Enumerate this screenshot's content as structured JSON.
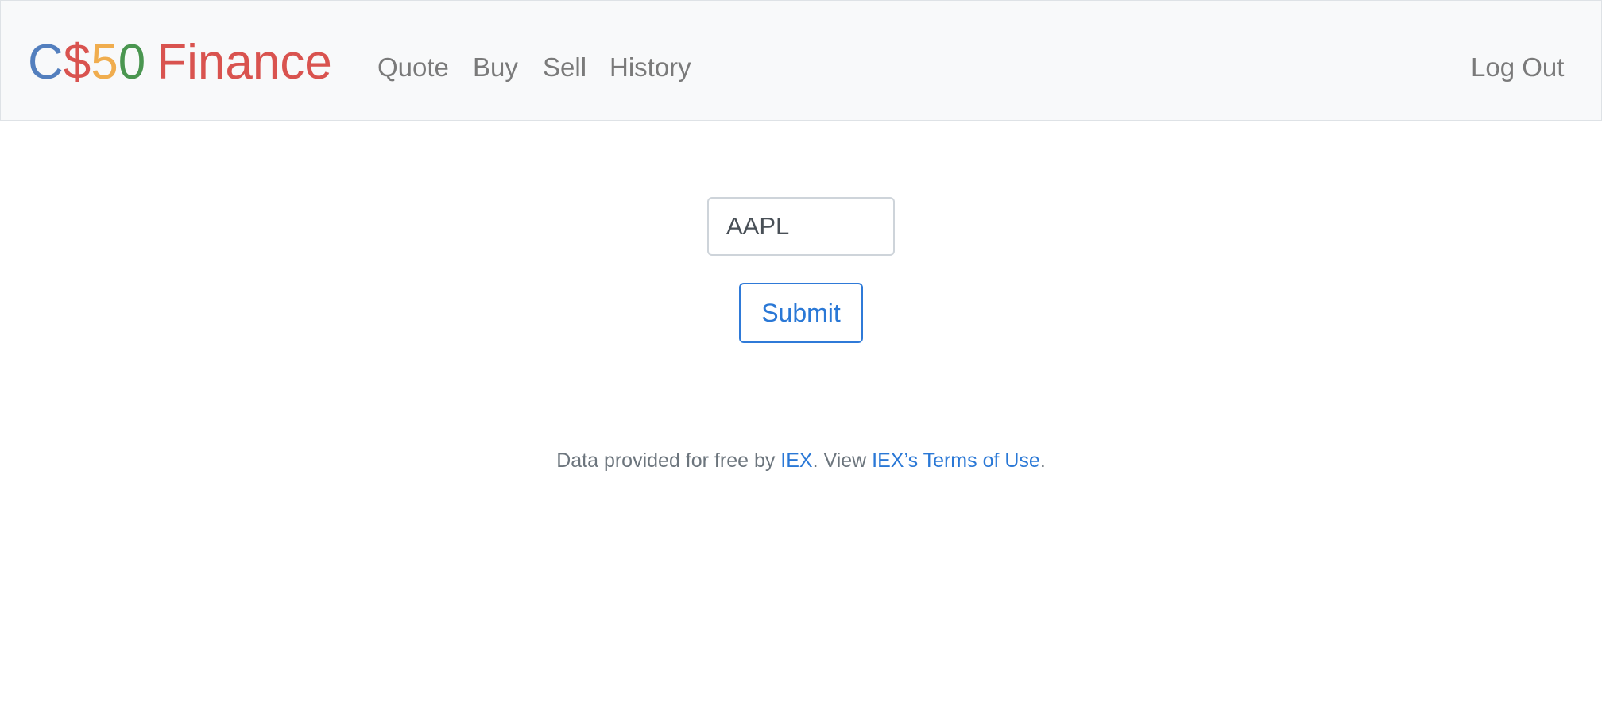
{
  "brand": {
    "c": "C",
    "dollar": "$",
    "five": "5",
    "zero": "0",
    "finance": "Finance",
    "colors": {
      "c": "#537fbe",
      "dollar": "#d9534f",
      "five": "#f0ad4e",
      "zero": "#4a9650",
      "finance": "#d9534f"
    }
  },
  "nav": {
    "items": [
      {
        "label": "Quote"
      },
      {
        "label": "Buy"
      },
      {
        "label": "Sell"
      },
      {
        "label": "History"
      }
    ],
    "logout": "Log Out"
  },
  "form": {
    "symbol_value": "AAPL",
    "submit_label": "Submit"
  },
  "footer": {
    "prefix": "Data provided for free by ",
    "iex_link": "IEX",
    "middle": ". View ",
    "terms_link": "IEX’s Terms of Use",
    "suffix": ".",
    "link_color": "#2a78d6"
  }
}
